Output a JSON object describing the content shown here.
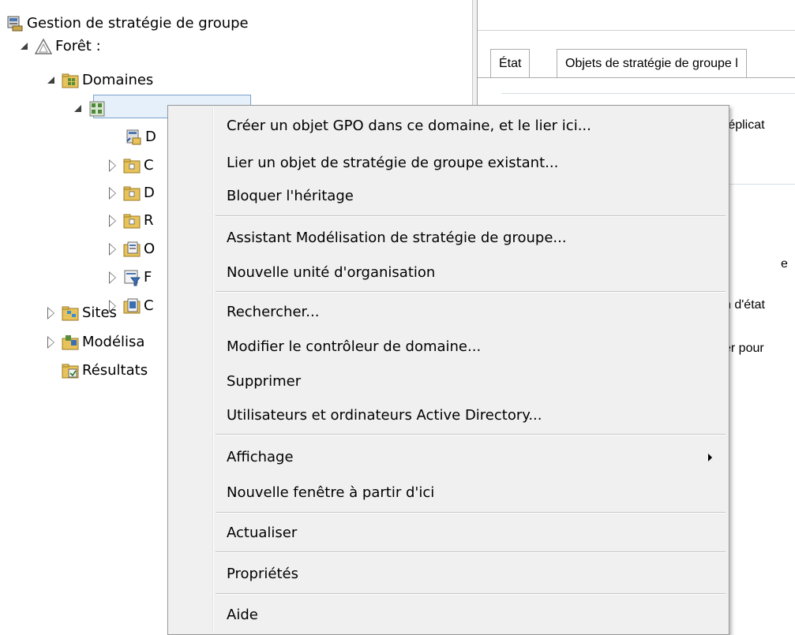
{
  "tree": {
    "root_label": "Gestion de stratégie de groupe",
    "forest_label": "Forêt :",
    "domains_label": "Domaines",
    "domain_label": "",
    "children": [
      {
        "label": "D",
        "icon": "gpo-link-icon"
      },
      {
        "label": "C",
        "icon": "ou-folder-icon"
      },
      {
        "label": "D",
        "icon": "ou-folder-icon"
      },
      {
        "label": "R",
        "icon": "ou-folder-icon"
      },
      {
        "label": "O",
        "icon": "gpo-container-icon"
      },
      {
        "label": "F",
        "icon": "wmi-filter-icon"
      },
      {
        "label": "C",
        "icon": "starter-gpo-icon"
      }
    ],
    "sites_label": "Sites",
    "modeling_label": "Modélisa",
    "results_label": "Résultats"
  },
  "right_pane": {
    "tabs": [
      "État",
      "Objets de stratégie de groupe l"
    ],
    "fragments": [
      "réplicat",
      "e",
      "n d'état",
      "er pour"
    ]
  },
  "context_menu": {
    "items": [
      "Créer un objet GPO dans ce domaine, et le lier ici...",
      "Lier un objet de stratégie de groupe existant...",
      "Bloquer l'héritage",
      "Assistant Modélisation de stratégie de groupe...",
      "Nouvelle unité d'organisation",
      "Rechercher...",
      "Modifier le contrôleur de domaine...",
      "Supprimer",
      "Utilisateurs et ordinateurs Active Directory...",
      "Affichage",
      "Nouvelle fenêtre à partir d'ici",
      "Actualiser",
      "Propriétés",
      "Aide"
    ]
  },
  "colors": {
    "menu_background": "#f0f0f0",
    "selection_fill": "#e5f0fb",
    "selection_border": "#7da2ce"
  }
}
